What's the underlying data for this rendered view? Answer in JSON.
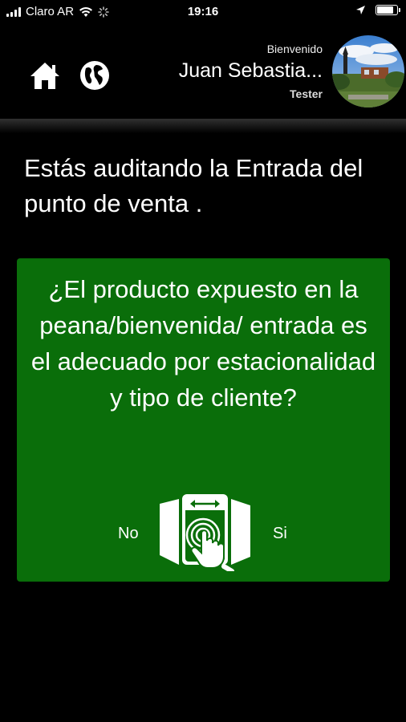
{
  "status_bar": {
    "carrier": "Claro AR",
    "time": "19:16",
    "icons": [
      "signal-icon",
      "wifi-icon",
      "activity-spinner-icon",
      "location-arrow-icon",
      "battery-icon"
    ],
    "battery_level": 0.85
  },
  "header": {
    "welcome": "Bienvenido",
    "user_name": "Juan Sebastia...",
    "role": "Tester",
    "icons": [
      "home-icon",
      "globe-icon",
      "avatar"
    ]
  },
  "intro_text": "Estás auditando la Entrada del punto de venta .",
  "question_card": {
    "question": "¿El producto expuesto en la peana/bienvenida/ entrada es el adecuado por estacionalidad y tipo de cliente?",
    "no_label": "No",
    "yes_label": "Si",
    "icon": "swipe-gesture-icon"
  },
  "colors": {
    "background": "#000000",
    "card": "#0a6e0a",
    "text": "#ffffff"
  }
}
